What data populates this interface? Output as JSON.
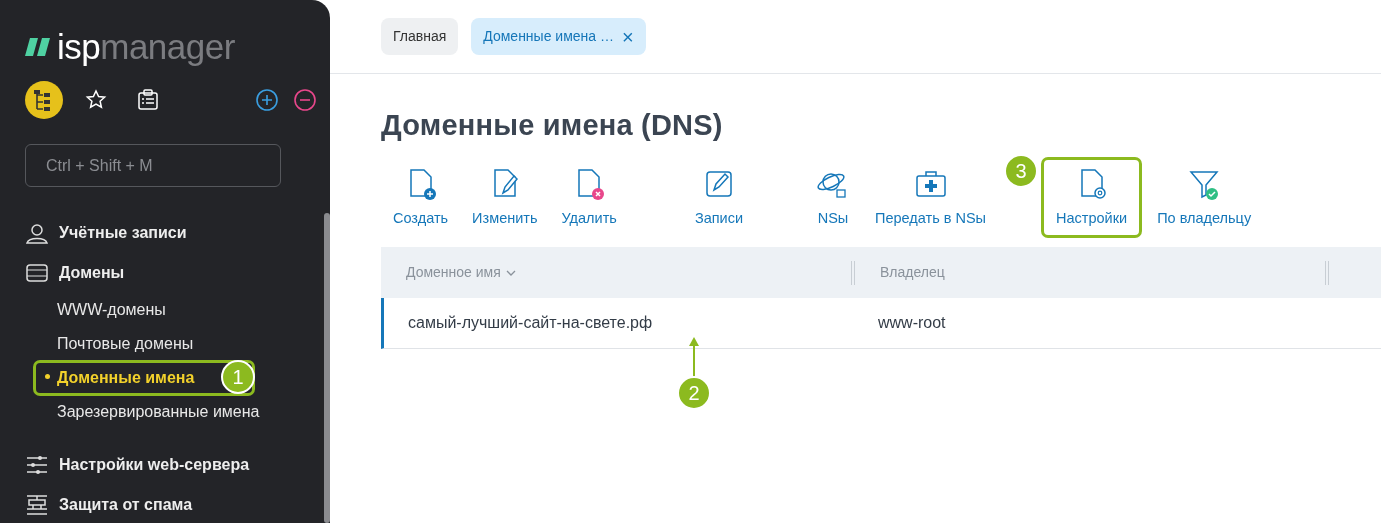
{
  "logo": {
    "brand_part_1": "isp",
    "brand_part_2": "manager"
  },
  "sidebar": {
    "top_icons": [
      {
        "selected": true
      },
      {
        "selected": false
      },
      {
        "selected": false
      }
    ],
    "search": {
      "placeholder": "Ctrl + Shift + M"
    },
    "items": [
      {
        "label": "Учётные записи"
      },
      {
        "label": "Домены",
        "children": [
          {
            "label": "WWW-домены",
            "selected": false
          },
          {
            "label": "Почтовые домены",
            "selected": false
          },
          {
            "label": "Доменные имена",
            "selected": true,
            "callout": {
              "label": "1",
              "kind": "frame"
            }
          },
          {
            "label": "Зарезервированные имена",
            "selected": false
          }
        ]
      },
      {
        "label": "Настройки web-сервера"
      },
      {
        "label": "Защита от спама"
      }
    ]
  },
  "tabs": [
    {
      "label": "Главная",
      "selected": false
    },
    {
      "label": "Доменные имена …",
      "selected": true,
      "close": "×"
    }
  ],
  "page_title": "Доменные имена (DNS)",
  "toolbar_groups": [
    {
      "buttons": [
        {
          "label": "Создать"
        },
        {
          "label": "Изменить"
        },
        {
          "label": "Удалить"
        }
      ]
    },
    {
      "buttons": [
        {
          "label": "Записи"
        }
      ]
    },
    {
      "buttons": [
        {
          "label": "NSы"
        },
        {
          "label": "Передать в NSы"
        }
      ]
    },
    {
      "buttons": [
        {
          "label": "Настройки",
          "callout": {
            "label": "3",
            "kind": "frame"
          }
        },
        {
          "label": "По владельцу"
        }
      ]
    }
  ],
  "table": {
    "columns": [
      {
        "label": "Доменное имя",
        "sorted": true
      },
      {
        "label": "Владелец",
        "sorted": false
      }
    ],
    "rows": [
      {
        "selected": true,
        "cells": [
          "самый-лучший-сайт-на-свете.рф",
          "www-root"
        ],
        "callout": {
          "label": "2",
          "kind": "arrow"
        }
      }
    ]
  }
}
